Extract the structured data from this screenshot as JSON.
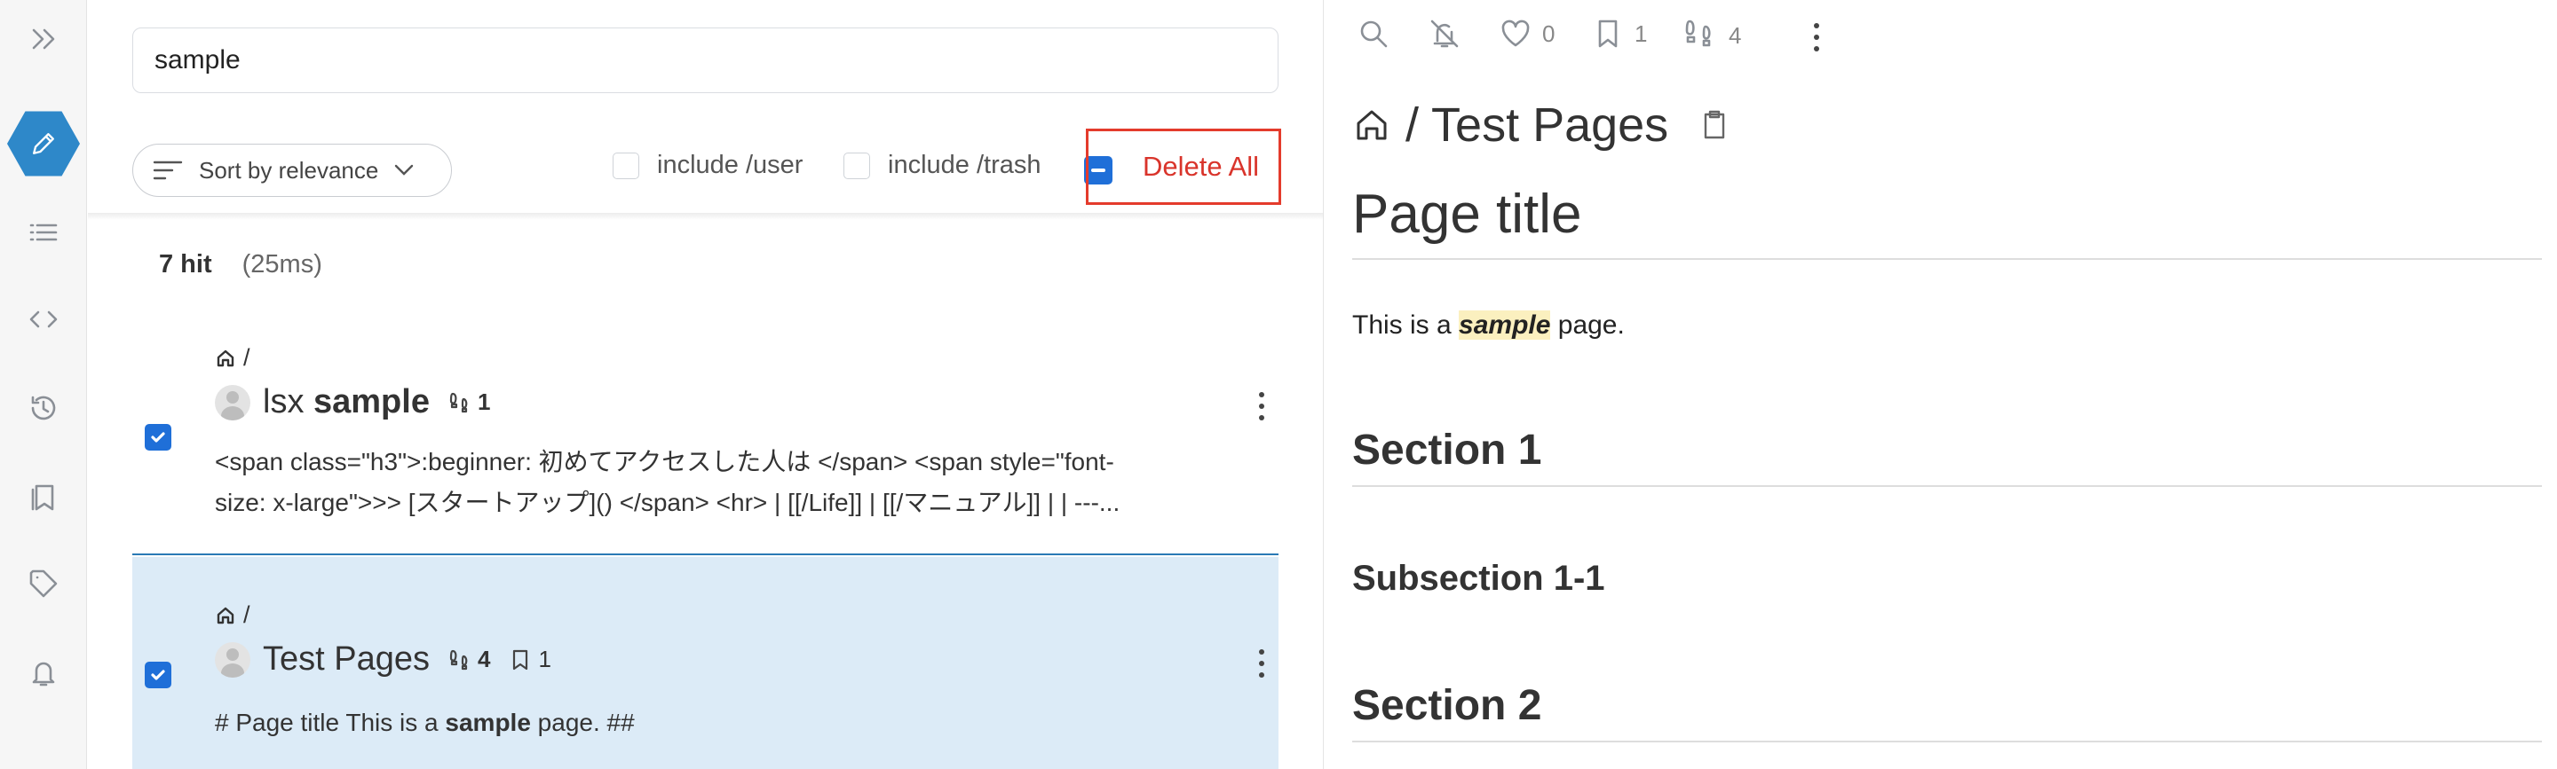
{
  "search": {
    "value": "sample",
    "placeholder": ""
  },
  "toolbar": {
    "sort_label": "Sort by relevance",
    "include_user_label": "include /user",
    "include_trash_label": "include /trash",
    "delete_all_label": "Delete All"
  },
  "hits": {
    "count": "7 hit",
    "time": "(25ms)"
  },
  "results": [
    {
      "path": "/",
      "title_prefix": "lsx ",
      "title_match": "sample",
      "footprints": "1",
      "snippet_line1": "<span class=\"h3\">:beginner: 初めてアクセスした人は </span> <span style=\"font-",
      "snippet_line2": "size: x-large\">>> [スタートアップ]() </span> <hr> | [[/Life]] | [[/マニュアル]] | | ---...",
      "checked": true
    },
    {
      "path": "/",
      "title": "Test Pages",
      "footprints": "4",
      "bookmarks": "1",
      "snippet_before": "# Page title This is a ",
      "snippet_match": "sample",
      "snippet_after": " page. ##",
      "checked": true
    }
  ],
  "preview": {
    "likes": "0",
    "bookmarks": "1",
    "footprints": "4",
    "path": "/ Test Pages",
    "heading1": "Page title",
    "body_before": "This is a ",
    "body_match": "sample",
    "body_after": " page.",
    "section1": "Section 1",
    "subsection": "Subsection 1-1",
    "section2": "Section 2"
  },
  "colors": {
    "accent": "#1f6fd8",
    "brand": "#2e88c9",
    "danger": "#d9342b",
    "selected_row": "#dcebf7"
  }
}
